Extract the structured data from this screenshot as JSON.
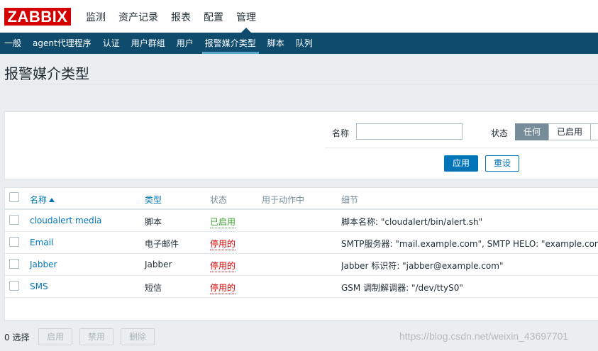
{
  "logo": "ZABBIX",
  "main_nav": [
    "监测",
    "资产记录",
    "报表",
    "配置",
    "管理"
  ],
  "sub_nav": [
    "一般",
    "agent代理程序",
    "认证",
    "用户群组",
    "用户",
    "报警媒介类型",
    "脚本",
    "队列"
  ],
  "page_title": "报警媒介类型",
  "filter": {
    "name_label": "名称",
    "name_value": "",
    "status_label": "状态",
    "status_options": [
      "任何",
      "已启用"
    ],
    "selected_status": "任何",
    "apply_label": "应用",
    "reset_label": "重设"
  },
  "table": {
    "headers": {
      "name": "名称",
      "type": "类型",
      "status": "状态",
      "used_in_actions": "用于动作中",
      "details": "细节"
    },
    "sort_column": "name",
    "rows": [
      {
        "name": "cloudalert media",
        "type": "脚本",
        "status": "已启用",
        "used_in_actions": "",
        "details": "脚本名称: \"cloudalert/bin/alert.sh\""
      },
      {
        "name": "Email",
        "type": "电子邮件",
        "status": "停用的",
        "used_in_actions": "",
        "details": "SMTP服务器: \"mail.example.com\", SMTP HELO: \"example.com\", SMTP电邮: \"zabbix@example.com\""
      },
      {
        "name": "Jabber",
        "type": "Jabber",
        "status": "停用的",
        "used_in_actions": "",
        "details": "Jabber 标识符: \"jabber@example.com\""
      },
      {
        "name": "SMS",
        "type": "短信",
        "status": "停用的",
        "used_in_actions": "",
        "details": "GSM 调制解调器: \"/dev/ttyS0\""
      }
    ]
  },
  "footer": {
    "selected_count": "0 选择",
    "enable_label": "启用",
    "disable_label": "禁用",
    "delete_label": "删除"
  },
  "watermark": "https://blog.csdn.net/weixin_43697701"
}
